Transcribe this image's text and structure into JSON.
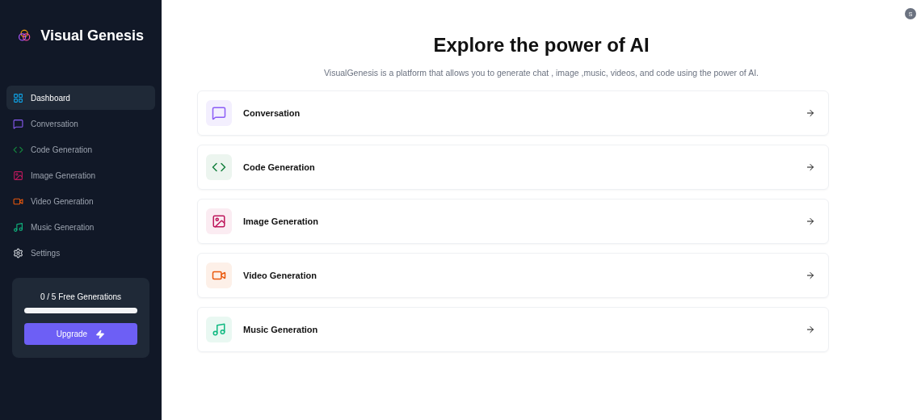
{
  "sidebar": {
    "brand": "Visual Genesis",
    "items": [
      {
        "label": "Dashboard",
        "kind": "dashboard",
        "selected": true
      },
      {
        "label": "Conversation",
        "kind": "conversation",
        "selected": false
      },
      {
        "label": "Code Generation",
        "kind": "code",
        "selected": false
      },
      {
        "label": "Image Generation",
        "kind": "image",
        "selected": false
      },
      {
        "label": "Video Generation",
        "kind": "video",
        "selected": false
      },
      {
        "label": "Music Generation",
        "kind": "music",
        "selected": false
      },
      {
        "label": "Settings",
        "kind": "settings",
        "selected": false
      }
    ],
    "usage": {
      "label": "0 / 5 Free Generations",
      "level": 0,
      "button": "Upgrade"
    }
  },
  "avatar": {
    "initial": "S"
  },
  "main": {
    "title": "Explore the power of AI",
    "subtitle": "VisualGenesis is a platform that allows you to generate chat , image ,music, videos, and code using the power of AI.",
    "tools": [
      {
        "label": "Conversation",
        "kind": "conversation"
      },
      {
        "label": "Code Generation",
        "kind": "code"
      },
      {
        "label": "Image Generation",
        "kind": "image"
      },
      {
        "label": "Video Generation",
        "kind": "video"
      },
      {
        "label": "Music Generation",
        "kind": "music"
      }
    ]
  }
}
